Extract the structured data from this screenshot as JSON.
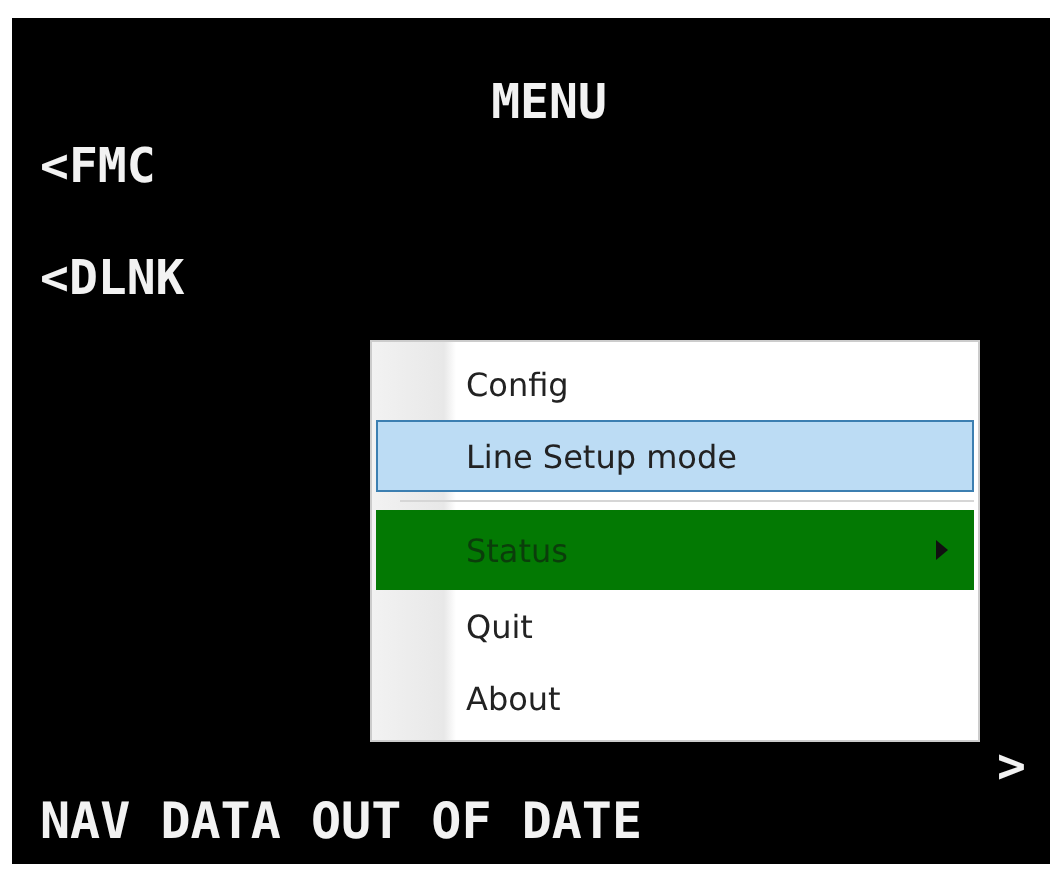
{
  "screen": {
    "title": "MENU",
    "left_keys": [
      "<FMC",
      "<DLNK"
    ],
    "right_key": ">",
    "scratchpad": "NAV DATA OUT OF DATE"
  },
  "context_menu": {
    "items": [
      {
        "kind": "item",
        "label": "Config",
        "selected": false,
        "open": false
      },
      {
        "kind": "item",
        "label": "Line Setup mode",
        "selected": true,
        "open": false
      },
      {
        "kind": "separator"
      },
      {
        "kind": "submenu",
        "label": "Status",
        "selected": false,
        "open": true
      },
      {
        "kind": "item",
        "label": "Quit",
        "selected": false,
        "open": false
      },
      {
        "kind": "item",
        "label": "About",
        "selected": false,
        "open": false
      }
    ]
  }
}
